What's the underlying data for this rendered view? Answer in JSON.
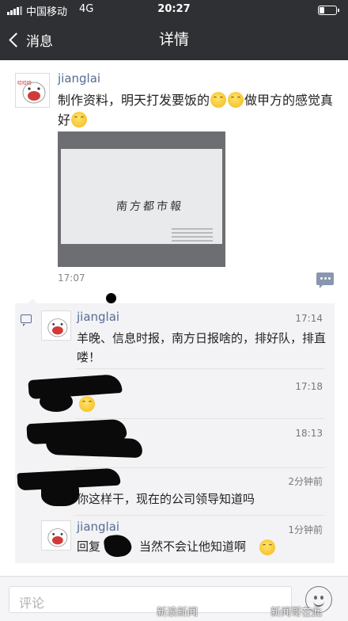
{
  "status_bar": {
    "carrier": "中国移动",
    "network": "4G",
    "time": "20:27"
  },
  "nav": {
    "back_label": "消息",
    "title": "详情"
  },
  "post": {
    "author": "jianglai",
    "text_part1": "制作资料，明天打发要饭的",
    "text_part2": "做甲方的感觉真好",
    "image_text": "南方都市報",
    "time": "17:07"
  },
  "comments": [
    {
      "author": "jianglai",
      "time": "17:14",
      "text": "羊晚、信息时报，南方日报啥的，排好队，排直喽！"
    },
    {
      "author": "",
      "time": "17:18",
      "text": ""
    },
    {
      "author": "",
      "time": "18:13",
      "text": ""
    },
    {
      "author": "",
      "time": "2分钟前",
      "text": "你这样干，现在的公司领导知道吗"
    },
    {
      "author": "jianglai",
      "time": "1分钟前",
      "reply_prefix": "回复",
      "text": "当然不会让他知道啊"
    }
  ],
  "input": {
    "placeholder": "评论"
  },
  "watermarks": {
    "left": "新浪新闻",
    "right": "新闻哥在此"
  },
  "colors": {
    "nav_bg": "#2f3033",
    "name_link": "#576b95",
    "comment_bg": "#f3f3f5"
  },
  "icons": [
    "signal-icon",
    "battery-icon",
    "back-chevron-icon",
    "emoji-icon",
    "comment-action-icon",
    "comment-list-icon",
    "smiley-icon"
  ]
}
